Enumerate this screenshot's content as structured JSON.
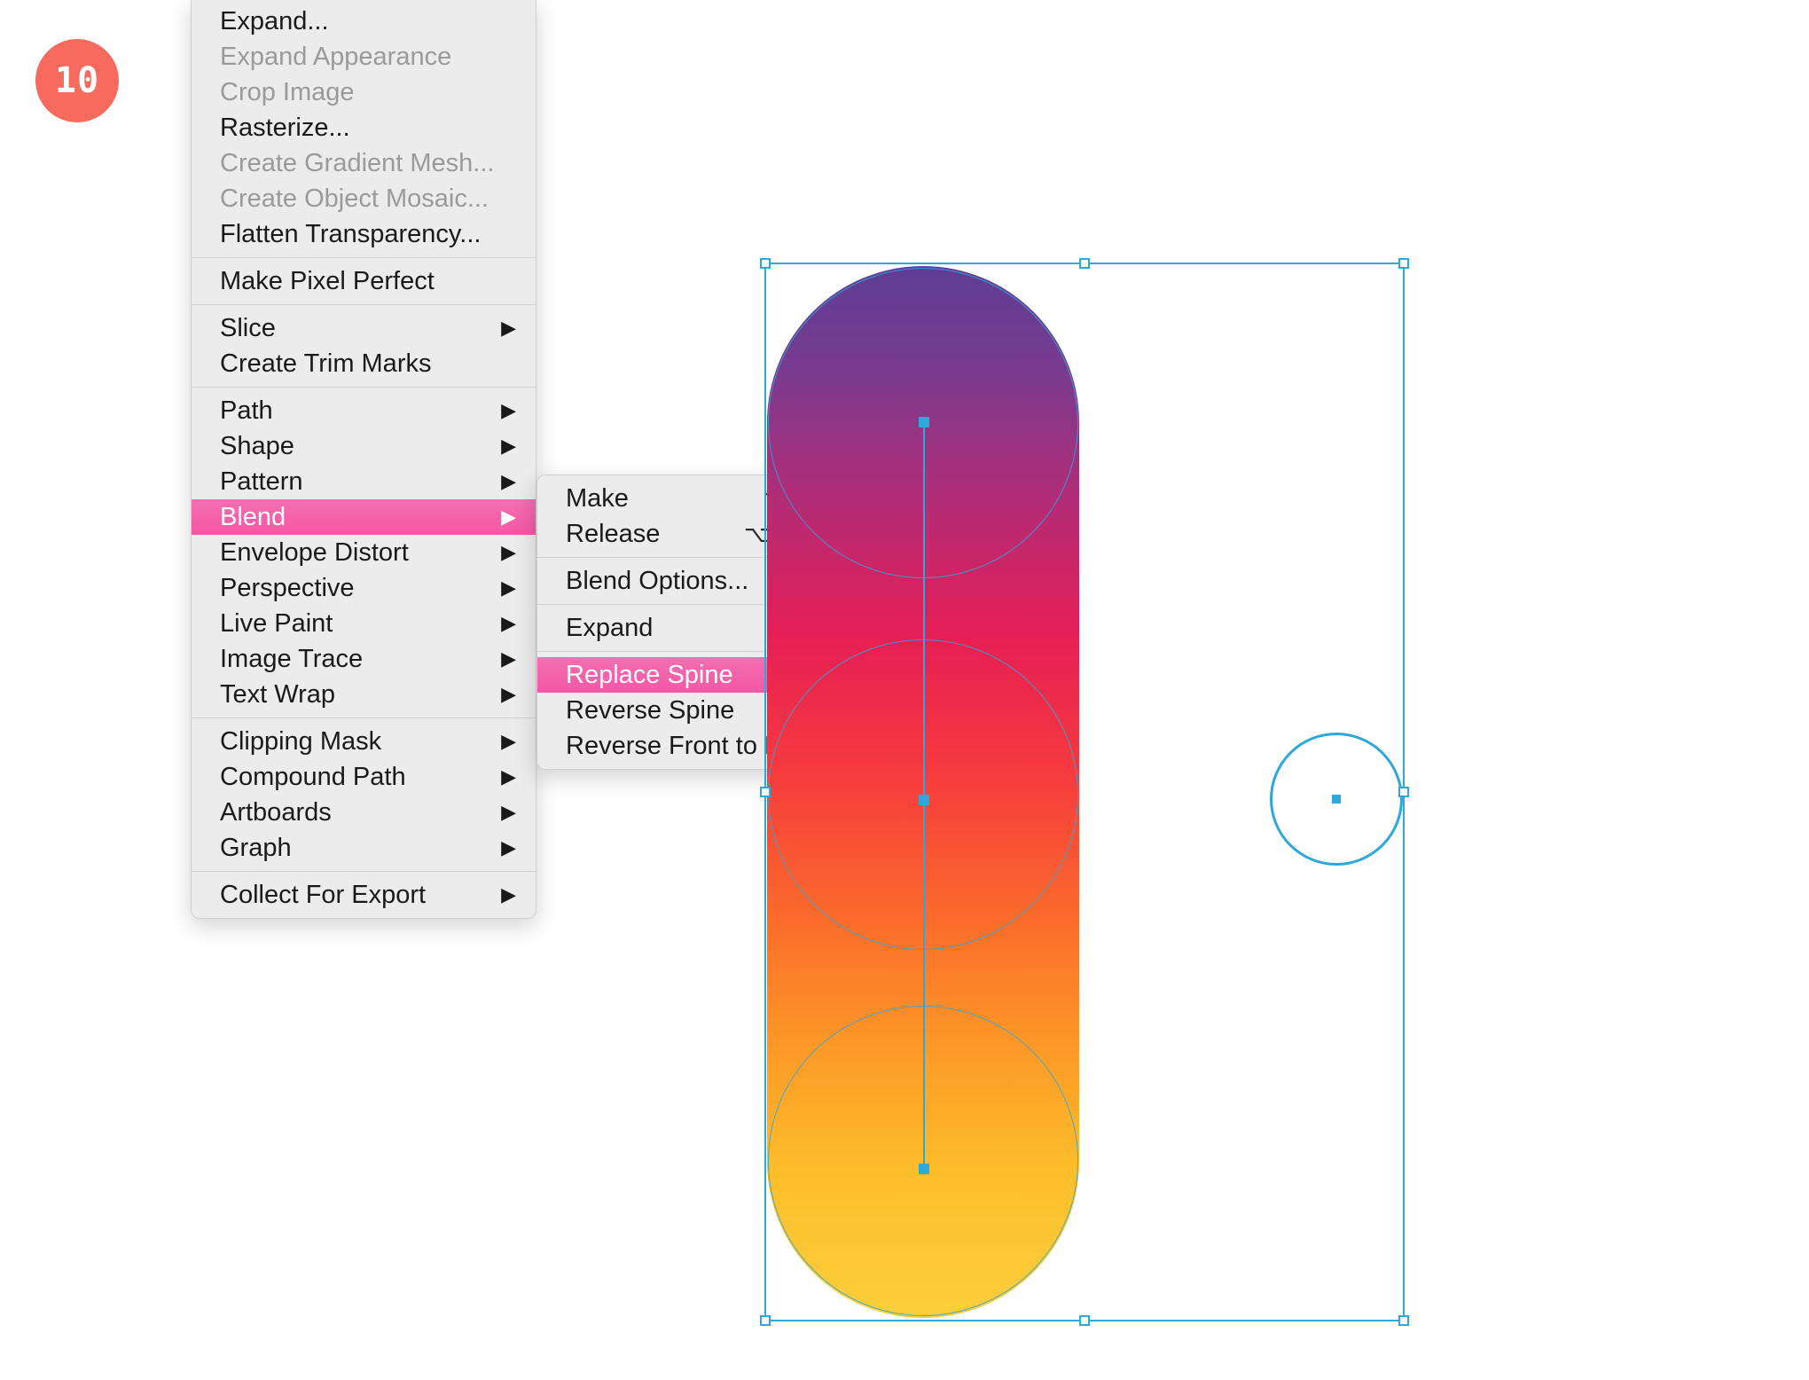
{
  "step_badge": "10",
  "menu": {
    "items": [
      {
        "label": "Expand...",
        "disabled": false,
        "submenu": false
      },
      {
        "label": "Expand Appearance",
        "disabled": true,
        "submenu": false
      },
      {
        "label": "Crop Image",
        "disabled": true,
        "submenu": false
      },
      {
        "label": "Rasterize...",
        "disabled": false,
        "submenu": false
      },
      {
        "label": "Create Gradient Mesh...",
        "disabled": true,
        "submenu": false
      },
      {
        "label": "Create Object Mosaic...",
        "disabled": true,
        "submenu": false
      },
      {
        "label": "Flatten Transparency...",
        "disabled": false,
        "submenu": false
      }
    ],
    "pixel_perfect": "Make Pixel Perfect",
    "slice": "Slice",
    "trim_marks": "Create Trim Marks",
    "groupA": [
      {
        "label": "Path"
      },
      {
        "label": "Shape"
      },
      {
        "label": "Pattern"
      },
      {
        "label": "Blend",
        "highlight": true
      },
      {
        "label": "Envelope Distort"
      },
      {
        "label": "Perspective"
      },
      {
        "label": "Live Paint"
      },
      {
        "label": "Image Trace"
      },
      {
        "label": "Text Wrap"
      }
    ],
    "groupB": [
      {
        "label": "Clipping Mask"
      },
      {
        "label": "Compound Path"
      },
      {
        "label": "Artboards"
      },
      {
        "label": "Graph"
      }
    ],
    "collect": "Collect For Export"
  },
  "submenu": {
    "make": {
      "label": "Make",
      "shortcut": "⌥⌘B"
    },
    "release": {
      "label": "Release",
      "shortcut": "⌥⇧⌘B"
    },
    "options": "Blend Options...",
    "expand": "Expand",
    "replace_spine": "Replace Spine",
    "reverse_spine": "Reverse Spine",
    "reverse_ftb": "Reverse Front to Back"
  },
  "colors": {
    "highlight": "#F557A4",
    "selection_blue": "#2DA8D8",
    "badge": "#F76A5E"
  }
}
